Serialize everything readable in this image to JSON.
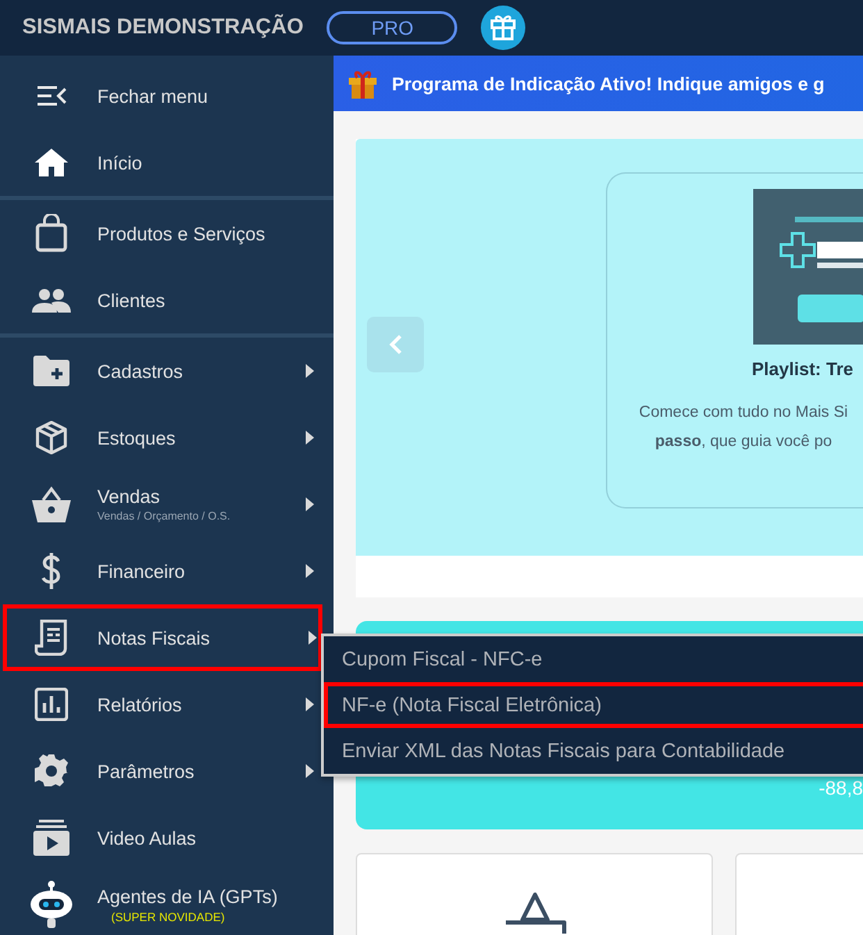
{
  "header": {
    "title": "SISMAIS DEMONSTRAÇÃO",
    "plan_badge": "PRO"
  },
  "sidebar": {
    "items": [
      {
        "label": "Fechar menu",
        "has_submenu": false,
        "highlighted": false,
        "divider_after": false
      },
      {
        "label": "Início",
        "has_submenu": false,
        "highlighted": false,
        "divider_after": true
      },
      {
        "label": "Produtos e Serviços",
        "has_submenu": false,
        "highlighted": false,
        "divider_after": false
      },
      {
        "label": "Clientes",
        "has_submenu": false,
        "highlighted": false,
        "divider_after": true
      },
      {
        "label": "Cadastros",
        "has_submenu": true,
        "highlighted": false,
        "divider_after": false
      },
      {
        "label": "Estoques",
        "has_submenu": true,
        "highlighted": false,
        "divider_after": false
      },
      {
        "label": "Vendas",
        "subtitle": "Vendas / Orçamento / O.S.",
        "has_submenu": true,
        "highlighted": false,
        "divider_after": false
      },
      {
        "label": "Financeiro",
        "has_submenu": true,
        "highlighted": false,
        "divider_after": false
      },
      {
        "label": "Notas Fiscais",
        "has_submenu": true,
        "highlighted": true,
        "divider_after": false
      },
      {
        "label": "Relatórios",
        "has_submenu": true,
        "highlighted": false,
        "divider_after": false
      },
      {
        "label": "Parâmetros",
        "has_submenu": true,
        "highlighted": false,
        "divider_after": false
      },
      {
        "label": "Video Aulas",
        "has_submenu": false,
        "highlighted": false,
        "divider_after": false
      },
      {
        "label": "Agentes de IA (GPTs)",
        "badge": "(SUPER NOVIDADE)",
        "has_submenu": false,
        "highlighted": false,
        "divider_after": false
      }
    ]
  },
  "submenu": {
    "items": [
      {
        "label": "Cupom Fiscal - NFC-e",
        "highlighted": false
      },
      {
        "label": "NF-e (Nota Fiscal Eletrônica)",
        "highlighted": true
      },
      {
        "label": "Enviar XML das Notas Fiscais para Contabilidade",
        "highlighted": false
      }
    ]
  },
  "banner": {
    "text": "Programa de Indicação Ativo! Indique amigos e g"
  },
  "carousel": {
    "card": {
      "thumbnail": {
        "kind": "picture"
      },
      "title": "Playlist: Tre",
      "description": [
        "Comece com tudo no Mais Si",
        "**passo**, que guia você po"
      ]
    }
  },
  "summary_card": {
    "value": "-88,8"
  }
}
